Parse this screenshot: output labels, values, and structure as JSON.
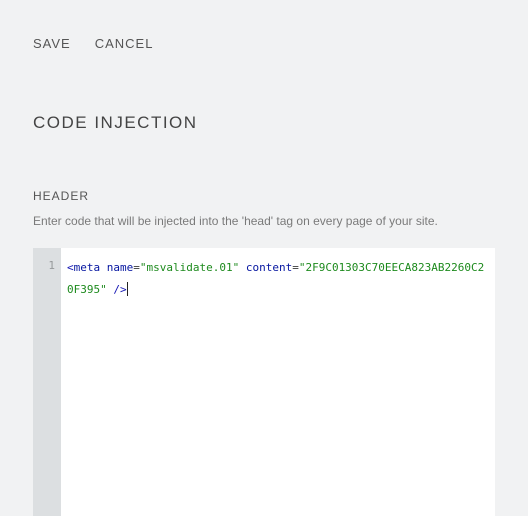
{
  "toolbar": {
    "save_label": "SAVE",
    "cancel_label": "CANCEL"
  },
  "page": {
    "title": "CODE INJECTION"
  },
  "header_section": {
    "label": "HEADER",
    "help": "Enter code that will be injected into the 'head' tag on every page of your site."
  },
  "editor": {
    "line_numbers": [
      "1"
    ],
    "code": {
      "open_angle": "<",
      "tag": "meta",
      "attr_name": "name",
      "eq": "=",
      "name_value": "\"msvalidate.01\"",
      "attr_content": "content",
      "content_value": "\"2F9C01303C70EECA823AB2260C20F395\"",
      "self_close": "/>"
    }
  }
}
